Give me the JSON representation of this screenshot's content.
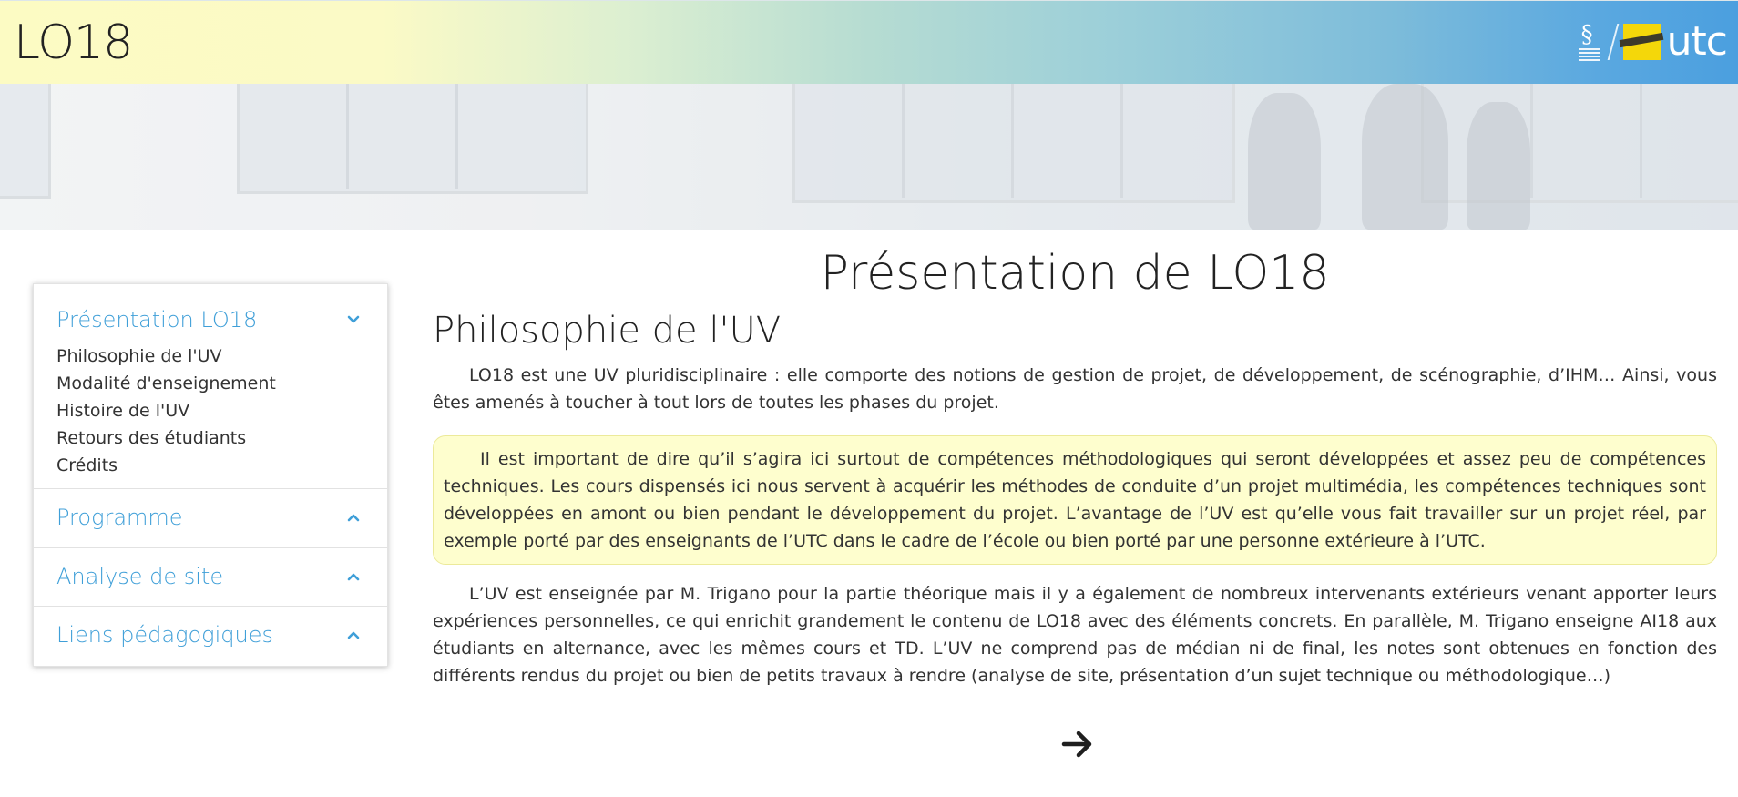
{
  "header": {
    "site_title": "LO18",
    "logo_text": "utc",
    "logo_mark": "alliance-sorbonne-universite-logo"
  },
  "hero": {
    "image": "campus-entrance-photo"
  },
  "sidebar": {
    "sections": [
      {
        "label": "Présentation LO18",
        "expanded": true,
        "icon": "chevron-down-icon",
        "items": [
          "Philosophie de l'UV",
          "Modalité d'enseignement",
          "Histoire de l'UV",
          "Retours des étudiants",
          "Crédits"
        ]
      },
      {
        "label": "Programme",
        "expanded": false,
        "icon": "chevron-up-icon"
      },
      {
        "label": "Analyse de site",
        "expanded": false,
        "icon": "chevron-up-icon"
      },
      {
        "label": "Liens pédagogiques",
        "expanded": false,
        "icon": "chevron-up-icon"
      }
    ]
  },
  "main": {
    "page_title": "Présentation de LO18",
    "section_title": "Philosophie de l'UV",
    "paragraph_1": "LO18 est une UV pluridisciplinaire : elle comporte des notions de gestion de projet, de développement, de scénographie, d’IHM… Ainsi, vous êtes amenés à toucher à tout lors de toutes les phases du projet.",
    "callout": "Il est important de dire qu’il s’agira ici surtout de compétences méthodologiques qui seront développées et assez peu de compétences techniques. Les cours dispensés ici nous servent à acquérir les méthodes de conduite d’un projet multimédia, les compétences techniques sont développées en amont ou bien pendant le développement du projet. L’avantage de l’UV est qu’elle vous fait travailler sur un projet réel, par exemple porté par des enseignants de l’UTC dans le cadre de l’école ou bien porté par une personne extérieure à l’UTC.",
    "paragraph_2": "L’UV est enseignée par M. Trigano pour la partie théorique mais il y a également de nombreux intervenants extérieurs venant apporter leurs expériences personnelles, ce qui enrichit grandement le contenu de LO18 avec des éléments concrets. En parallèle, M. Trigano enseigne AI18 aux étudiants en alternance, avec les mêmes cours et TD. L’UV ne comprend pas de médian ni de final, les notes sont obtenues en fonction des différents rendus du projet ou bien de petits travaux à rendre (analyse de site, présentation d’un sujet technique ou méthodologique…)",
    "next_icon": "arrow-right-icon"
  },
  "colors": {
    "accent_link": "#3f9fd8",
    "callout_bg": "#fefece",
    "callout_border": "#ecea9a"
  }
}
